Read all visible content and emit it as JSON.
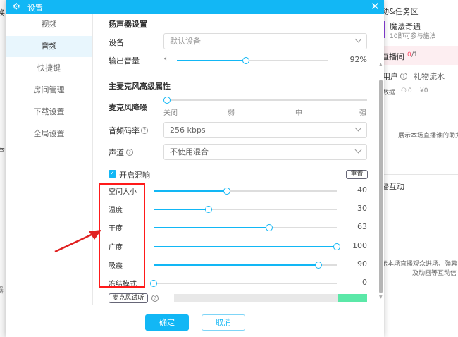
{
  "background_app": {
    "left_fragments": [
      "换",
      "空",
      "器"
    ],
    "task_area_title": "动&任务区",
    "magic_title": "魔法奇遇",
    "magic_sub": "10即可参与施法",
    "live_room": "直播间",
    "live_count_current": "0",
    "live_count_total": "/1",
    "tab_users": "用户",
    "tab_gifts": "礼物流水",
    "data_label": "数据",
    "data_users": "0",
    "data_money": "¥0",
    "help_text": "展示本场直播谁的助力",
    "interact_title": "播互动",
    "interact_desc1": "示本场直播观众进场、弹幕",
    "interact_desc2": "及动画等互动信"
  },
  "dialog": {
    "title": "设置",
    "sidebar": [
      {
        "label": "视频"
      },
      {
        "label": "音频"
      },
      {
        "label": "快捷键"
      },
      {
        "label": "房间管理"
      },
      {
        "label": "下载设置"
      },
      {
        "label": "全局设置"
      }
    ],
    "selected": "音频",
    "speaker_heading": "扬声器设置",
    "device_label": "设备",
    "device_value": "默认设备",
    "volume_label": "输出音量",
    "volume_value": 92,
    "volume_text": "92%",
    "mic_heading": "主麦克风高级属性",
    "noise_label": "麦克风降噪",
    "noise_levels": [
      "关闭",
      "弱",
      "中",
      "强"
    ],
    "bitrate_label": "音频码率",
    "bitrate_value": "256 kbps",
    "channel_label": "声道",
    "channel_value": "不使用混合",
    "reverb_label": "开启混响",
    "reverb_checked": true,
    "reset_label": "重置",
    "reverb_sliders": [
      {
        "label": "空间大小",
        "value": 40
      },
      {
        "label": "温度",
        "value": 30
      },
      {
        "label": "干度",
        "value": 63
      },
      {
        "label": "广度",
        "value": 100
      },
      {
        "label": "吸震",
        "value": 90
      },
      {
        "label": "冻结模式",
        "value": 0
      }
    ],
    "monitor_label": "麦克风试听",
    "ok_label": "确定",
    "cancel_label": "取消"
  },
  "colors": {
    "accent": "#12b7f5",
    "highlight": "#ff0000",
    "level": "#5be8a8"
  }
}
